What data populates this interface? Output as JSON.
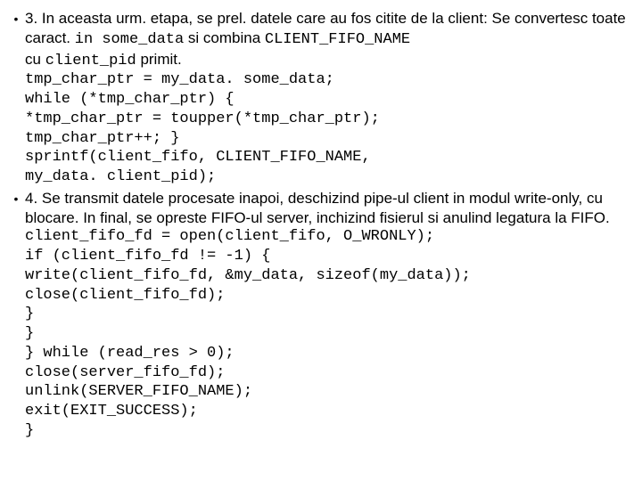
{
  "bullets": [
    {
      "marker": "•",
      "intro": {
        "t1": "3. In aceasta urm. etapa, se prel. datele care au fos citite de la client: Se convertesc toate caract. ",
        "c1": "in some_data",
        "t2": " si combina ",
        "c2": "CLIENT_FIFO_NAME",
        "t3": "cu ",
        "c3": "client_pid",
        "t4": " primit."
      },
      "code": "tmp_char_ptr = my_data. some_data;\nwhile (*tmp_char_ptr) {\n*tmp_char_ptr = toupper(*tmp_char_ptr);\ntmp_char_ptr++; }\nsprintf(client_fifo, CLIENT_FIFO_NAME,\nmy_data. client_pid);"
    },
    {
      "marker": "•",
      "intro_plain": "4. Se transmit datele procesate inapoi, deschizind pipe-ul client in modul write-only, cu blocare. In final, se opreste FIFO-ul server, inchizind fisierul si anulind legatura la  FIFO.",
      "code": "client_fifo_fd = open(client_fifo, O_WRONLY);\nif (client_fifo_fd != -1) {\nwrite(client_fifo_fd, &my_data, sizeof(my_data));\nclose(client_fifo_fd);\n}\n}\n} while (read_res > 0);\nclose(server_fifo_fd);\nunlink(SERVER_FIFO_NAME);\nexit(EXIT_SUCCESS);\n}"
    }
  ]
}
